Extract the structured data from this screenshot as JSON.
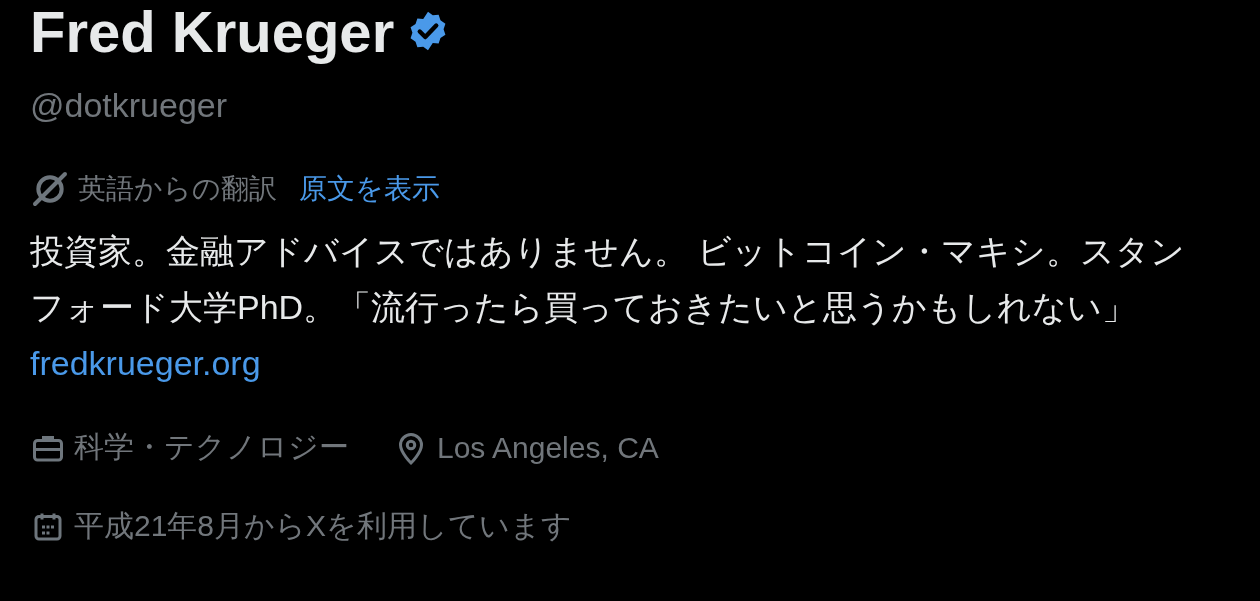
{
  "profile": {
    "name": "Fred Krueger",
    "verified": true,
    "handle": "@dotkrueger"
  },
  "translation": {
    "label": "英語からの翻訳",
    "link": "原文を表示"
  },
  "bio": {
    "text": "投資家。金融アドバイスではありません。 ビットコイン・マキシ。スタンフォード大学PhD。「流行ったら買っておきたいと思うかもしれない」",
    "link": "fredkrueger.org"
  },
  "details": [
    {
      "kind": "category",
      "text": "科学・テクノロジー"
    },
    {
      "kind": "location",
      "text": "Los Angeles, CA"
    }
  ],
  "joined": {
    "text": "平成21年8月からXを利用しています"
  }
}
